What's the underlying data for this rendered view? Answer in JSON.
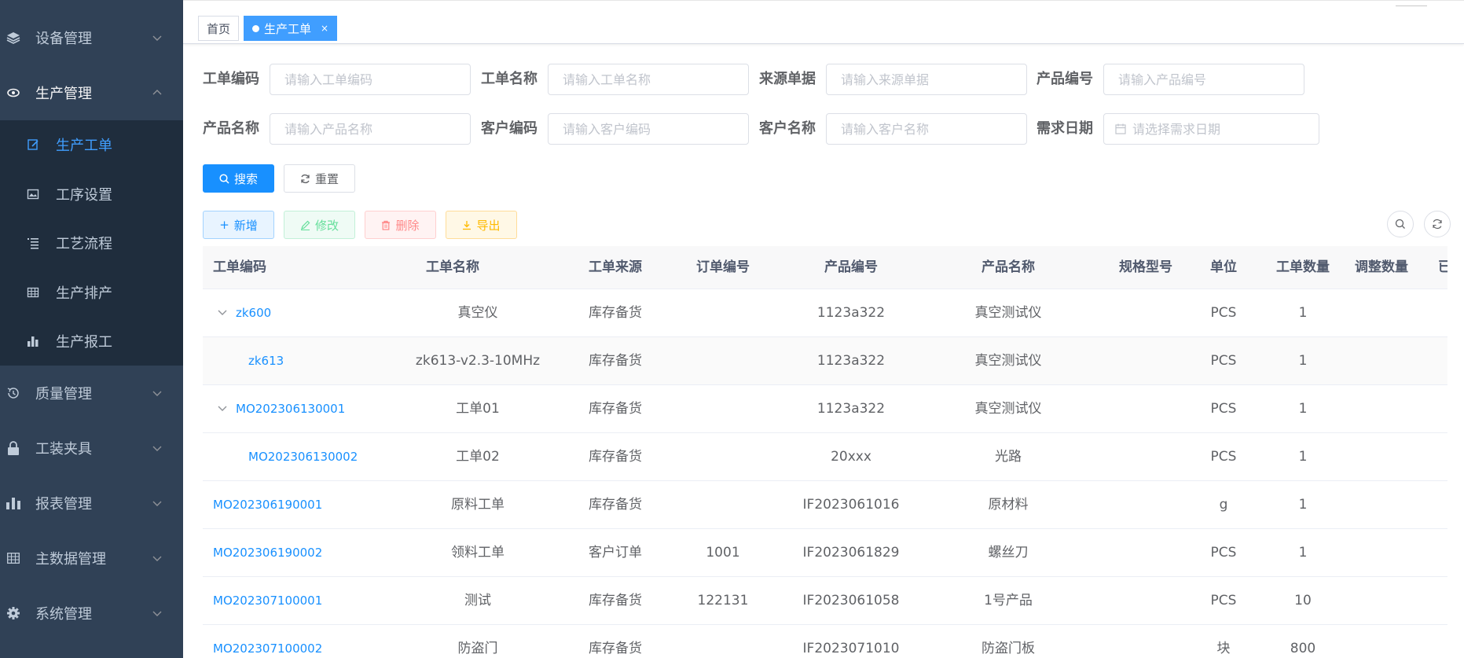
{
  "sidebar": {
    "items": [
      {
        "label": "设备管理",
        "icon": "layers-icon"
      },
      {
        "label": "生产管理",
        "icon": "eye-icon"
      },
      {
        "label": "质量管理",
        "icon": "clock-icon"
      },
      {
        "label": "工装夹具",
        "icon": "lock-icon"
      },
      {
        "label": "报表管理",
        "icon": "chart-icon"
      },
      {
        "label": "主数据管理",
        "icon": "grid-icon"
      },
      {
        "label": "系统管理",
        "icon": "gear-icon"
      }
    ],
    "submenu": [
      {
        "label": "生产工单",
        "icon": "edit-icon"
      },
      {
        "label": "工序设置",
        "icon": "image-icon"
      },
      {
        "label": "工艺流程",
        "icon": "list-icon"
      },
      {
        "label": "生产排产",
        "icon": "table-icon"
      },
      {
        "label": "生产报工",
        "icon": "bar-chart-icon"
      }
    ]
  },
  "tags": {
    "home": "首页",
    "current": "生产工单",
    "close": "×"
  },
  "form": {
    "fields": [
      {
        "label": "工单编码",
        "placeholder": "请输入工单编码"
      },
      {
        "label": "工单名称",
        "placeholder": "请输入工单名称"
      },
      {
        "label": "来源单据",
        "placeholder": "请输入来源单据"
      },
      {
        "label": "产品编号",
        "placeholder": "请输入产品编号"
      },
      {
        "label": "产品名称",
        "placeholder": "请输入产品名称"
      },
      {
        "label": "客户编码",
        "placeholder": "请输入客户编码"
      },
      {
        "label": "客户名称",
        "placeholder": "请输入客户名称"
      },
      {
        "label": "需求日期",
        "placeholder": "请选择需求日期"
      }
    ],
    "search": "搜索",
    "reset": "重置"
  },
  "toolbar": {
    "add": "新增",
    "edit": "修改",
    "delete": "删除",
    "export": "导出"
  },
  "table": {
    "headers": [
      "工单编码",
      "工单名称",
      "工单来源",
      "订单编号",
      "产品编号",
      "产品名称",
      "规格型号",
      "单位",
      "工单数量",
      "调整数量",
      "已"
    ],
    "rows": [
      {
        "code": "zk600",
        "name": "真空仪",
        "source": "库存备货",
        "order": "",
        "product_code": "1123a322",
        "product_name": "真空测试仪",
        "spec": "",
        "unit": "PCS",
        "qty": "1",
        "adjust": ""
      },
      {
        "code": "zk613",
        "name": "zk613-v2.3-10MHz",
        "source": "库存备货",
        "order": "",
        "product_code": "1123a322",
        "product_name": "真空测试仪",
        "spec": "",
        "unit": "PCS",
        "qty": "1",
        "adjust": ""
      },
      {
        "code": "MO202306130001",
        "name": "工单01",
        "source": "库存备货",
        "order": "",
        "product_code": "1123a322",
        "product_name": "真空测试仪",
        "spec": "",
        "unit": "PCS",
        "qty": "1",
        "adjust": ""
      },
      {
        "code": "MO202306130002",
        "name": "工单02",
        "source": "库存备货",
        "order": "",
        "product_code": "20xxx",
        "product_name": "光路",
        "spec": "",
        "unit": "PCS",
        "qty": "1",
        "adjust": ""
      },
      {
        "code": "MO202306190001",
        "name": "原料工单",
        "source": "库存备货",
        "order": "",
        "product_code": "IF2023061016",
        "product_name": "原材料",
        "spec": "",
        "unit": "g",
        "qty": "1",
        "adjust": ""
      },
      {
        "code": "MO202306190002",
        "name": "领料工单",
        "source": "客户订单",
        "order": "1001",
        "product_code": "IF2023061829",
        "product_name": "螺丝刀",
        "spec": "",
        "unit": "PCS",
        "qty": "1",
        "adjust": ""
      },
      {
        "code": "MO202307100001",
        "name": "测试",
        "source": "库存备货",
        "order": "122131",
        "product_code": "IF2023061058",
        "product_name": "1号产品",
        "spec": "",
        "unit": "PCS",
        "qty": "10",
        "adjust": ""
      },
      {
        "code": "MO202307100002",
        "name": "防盗门",
        "source": "库存备货",
        "order": "",
        "product_code": "IF2023071010",
        "product_name": "防盗门板",
        "spec": "",
        "unit": "块",
        "qty": "800",
        "adjust": ""
      }
    ]
  }
}
